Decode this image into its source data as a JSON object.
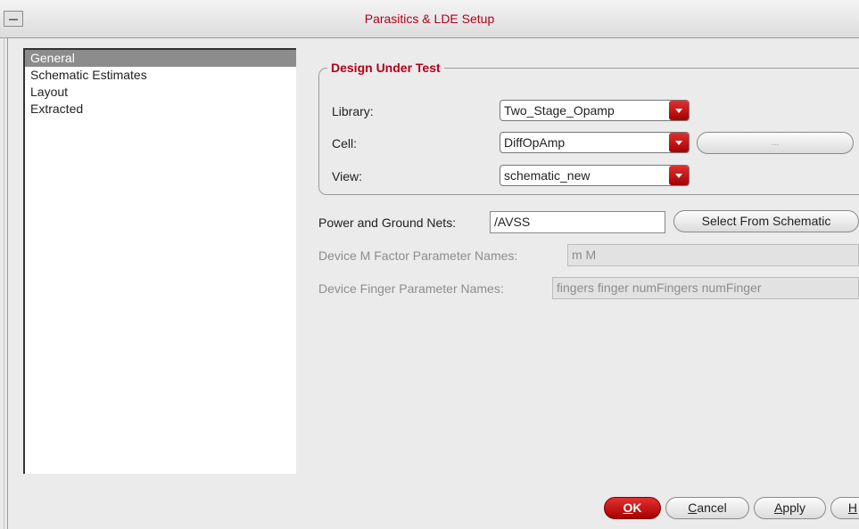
{
  "window": {
    "title": "Parasitics & LDE Setup"
  },
  "nav": {
    "items": [
      {
        "label": "General",
        "selected": true
      },
      {
        "label": "Schematic Estimates",
        "selected": false
      },
      {
        "label": "Layout",
        "selected": false
      },
      {
        "label": "Extracted",
        "selected": false
      }
    ]
  },
  "design_under_test": {
    "title": "Design Under Test",
    "library": {
      "label": "Library:",
      "value": "Two_Stage_Opamp"
    },
    "cell": {
      "label": "Cell:",
      "value": "DiffOpAmp",
      "browse_label": "..."
    },
    "view": {
      "label": "View:",
      "value": "schematic_new"
    }
  },
  "power_ground": {
    "label": "Power and Ground Nets:",
    "value": "/AVSS",
    "select_button": "Select From Schematic"
  },
  "m_factor": {
    "label": "Device M Factor Parameter Names:",
    "value": "m M"
  },
  "finger": {
    "label": "Device Finger Parameter Names:",
    "value": "fingers finger numFingers numFinger"
  },
  "buttons": {
    "ok": {
      "mnemonic": "O",
      "rest": "K"
    },
    "cancel": {
      "mnemonic": "C",
      "rest": "ancel"
    },
    "apply": {
      "mnemonic": "A",
      "rest": "pply"
    },
    "help": {
      "mnemonic": "H",
      "rest": ""
    }
  },
  "colors": {
    "accent": "#b0001a",
    "dropdown_arrow": "#c81010",
    "selection": "#8c8c8c"
  }
}
